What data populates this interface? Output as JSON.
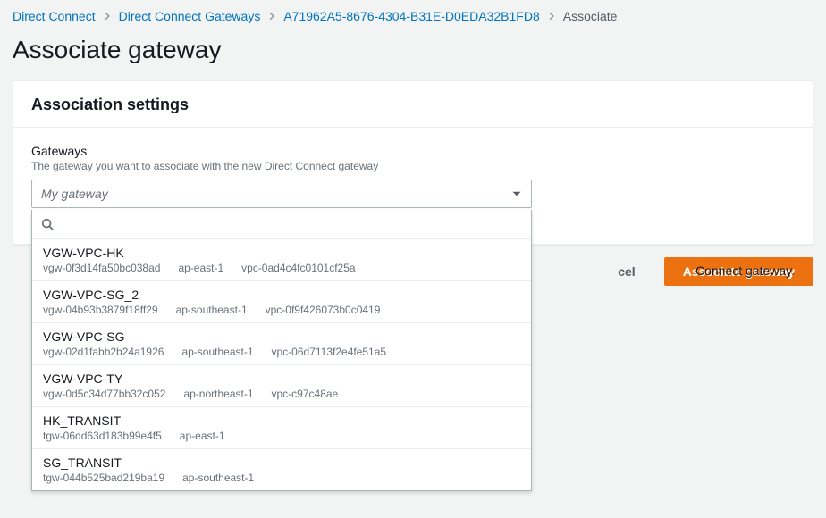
{
  "breadcrumb": {
    "root": "Direct Connect",
    "gateways": "Direct Connect Gateways",
    "gateway_id": "A71962A5-8676-4304-B31E-D0EDA32B1FD8",
    "current": "Associate"
  },
  "page_title": "Associate gateway",
  "panel_title": "Association settings",
  "gateways_field": {
    "label": "Gateways",
    "help": "The gateway you want to associate with the new Direct Connect gateway",
    "placeholder": "My gateway"
  },
  "hidden_help_fragment": "Connect gateway.",
  "dropdown": {
    "search_placeholder": "",
    "options": [
      {
        "name": "VGW-VPC-HK",
        "id": "vgw-0f3d14fa50bc038ad",
        "region": "ap-east-1",
        "vpc": "vpc-0ad4c4fc0101cf25a"
      },
      {
        "name": "VGW-VPC-SG_2",
        "id": "vgw-04b93b3879f18ff29",
        "region": "ap-southeast-1",
        "vpc": "vpc-0f9f426073b0c0419"
      },
      {
        "name": "VGW-VPC-SG",
        "id": "vgw-02d1fabb2b24a1926",
        "region": "ap-southeast-1",
        "vpc": "vpc-06d7113f2e4fe51a5"
      },
      {
        "name": "VGW-VPC-TY",
        "id": "vgw-0d5c34d77bb32c052",
        "region": "ap-northeast-1",
        "vpc": "vpc-c97c48ae"
      },
      {
        "name": "HK_TRANSIT",
        "id": "tgw-06dd63d183b99e4f5",
        "region": "ap-east-1",
        "vpc": ""
      },
      {
        "name": "SG_TRANSIT",
        "id": "tgw-044b525bad219ba19",
        "region": "ap-southeast-1",
        "vpc": ""
      }
    ]
  },
  "buttons": {
    "cancel": "cel",
    "submit": "Associate gateway"
  },
  "colors": {
    "link": "#0073bb",
    "primary": "#ec7211"
  }
}
